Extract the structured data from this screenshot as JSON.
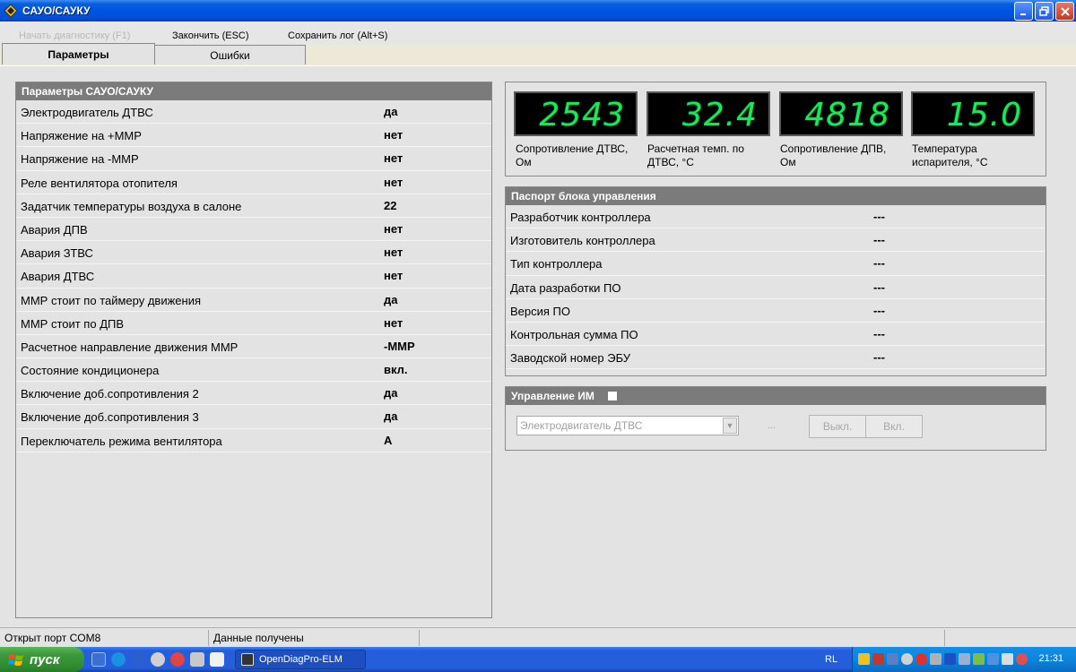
{
  "window": {
    "title": "САУО/САУКУ"
  },
  "menu": {
    "start_diag": "Начать диагностику (F1)",
    "finish": "Закончить (ESC)",
    "save_log": "Сохранить лог (Alt+S)"
  },
  "tabs": [
    {
      "label": "Параметры",
      "active": true
    },
    {
      "label": "Ошибки",
      "active": false
    }
  ],
  "params": {
    "header": "Параметры САУО/САУКУ",
    "rows": [
      {
        "name": "Электродвигатель ДТВС",
        "value": "да"
      },
      {
        "name": "Напряжение на +ММР",
        "value": "нет"
      },
      {
        "name": "Напряжение на -ММР",
        "value": "нет"
      },
      {
        "name": "Реле вентилятора отопителя",
        "value": "нет"
      },
      {
        "name": "Задатчик температуры воздуха в салоне",
        "value": "22"
      },
      {
        "name": "Авария ДПВ",
        "value": "нет"
      },
      {
        "name": "Авария ЗТВС",
        "value": "нет"
      },
      {
        "name": "Авария ДТВС",
        "value": "нет"
      },
      {
        "name": "ММР стоит по таймеру движения",
        "value": "да"
      },
      {
        "name": "ММР стоит по ДПВ",
        "value": "нет"
      },
      {
        "name": "Расчетное направление движения ММР",
        "value": "-ММР"
      },
      {
        "name": "Состояние кондиционера",
        "value": "вкл."
      },
      {
        "name": "Включение доб.сопротивления 2",
        "value": "да"
      },
      {
        "name": "Включение доб.сопротивления 3",
        "value": "да"
      },
      {
        "name": "Переключатель режима вентилятора",
        "value": "A"
      }
    ]
  },
  "displays": [
    {
      "value": "2543",
      "label_line1": "Сопротивление ДТВС,",
      "label_line2": "Ом"
    },
    {
      "value": "32.4",
      "label_line1": "Расчетная темп. по",
      "label_line2": "ДТВС, °С"
    },
    {
      "value": "4818",
      "label_line1": "Сопротивление ДПВ,",
      "label_line2": "Ом"
    },
    {
      "value": "15.0",
      "label_line1": "Температура",
      "label_line2": "испарителя, °С"
    }
  ],
  "passport": {
    "header": "Паспорт блока управления",
    "rows": [
      {
        "name": "Разработчик контроллера",
        "value": "---"
      },
      {
        "name": "Изготовитель контроллера",
        "value": "---"
      },
      {
        "name": "Тип контроллера",
        "value": "---"
      },
      {
        "name": "Дата разработки ПО",
        "value": "---"
      },
      {
        "name": "Версия ПО",
        "value": "---"
      },
      {
        "name": "Контрольная сумма ПО",
        "value": "---"
      },
      {
        "name": "Заводской номер ЭБУ",
        "value": "---"
      }
    ]
  },
  "control": {
    "header": "Управление ИМ",
    "combo_value": "Электродвигатель ДТВС",
    "dots": "...",
    "off_label": "Выкл.",
    "on_label": "Вкл."
  },
  "status": {
    "port": "Открыт порт COM8",
    "data": "Данные получены"
  },
  "taskbar": {
    "start_label": "пуск",
    "task_label": "OpenDiagPro-ELM",
    "lang": "RL",
    "clock": "21:31"
  },
  "colors": {
    "display_digits": "#18e85a",
    "panel_header": "#7b7b7b",
    "title_bar": "#0054e3",
    "taskbar": "#245edb",
    "start_button": "#3c9a3c"
  }
}
